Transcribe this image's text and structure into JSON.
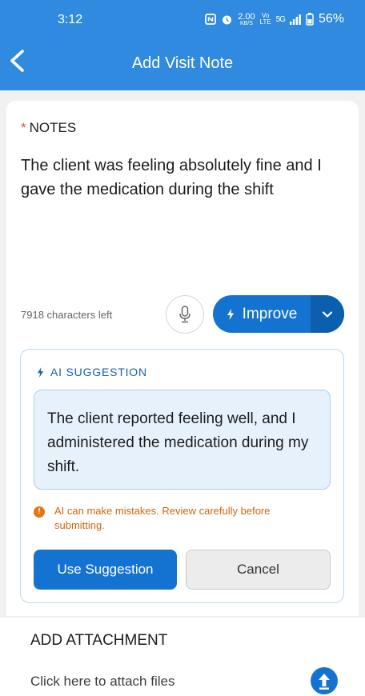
{
  "status_bar": {
    "time": "3:12",
    "network_speed_value": "2.00",
    "network_speed_unit": "KB/S",
    "network_type": "Vo LTE",
    "signal": "5G",
    "battery": "56%"
  },
  "header": {
    "title": "Add Visit Note"
  },
  "notes": {
    "required_marker": "*",
    "label": "NOTES",
    "text": "The client was feeling absolutely fine and I gave the medication during the shift",
    "characters_left": "7918 characters left"
  },
  "improve_button": {
    "label": "Improve"
  },
  "ai_suggestion": {
    "header": "AI SUGGESTION",
    "text": "The client reported feeling well, and I administered the medication during my shift.",
    "warning_icon": "!",
    "warning": "AI can make mistakes. Review carefully before submitting.",
    "use_label": "Use Suggestion",
    "cancel_label": "Cancel"
  },
  "attachment": {
    "title": "ADD ATTACHMENT",
    "hint": "Click here to attach files"
  },
  "colors": {
    "header": "#2f8ae0",
    "primary": "#1473d0",
    "ai_border": "#b9d6f3",
    "suggestion_bg": "#e7f1fc",
    "warning": "#d8630d",
    "required": "#e44b3e"
  },
  "icons": [
    "nfc-icon",
    "alarm-icon",
    "signal-icon",
    "battery-icon",
    "back-arrow-icon",
    "microphone-icon",
    "lightning-icon",
    "chevron-down-icon",
    "warning-icon",
    "upload-icon"
  ]
}
